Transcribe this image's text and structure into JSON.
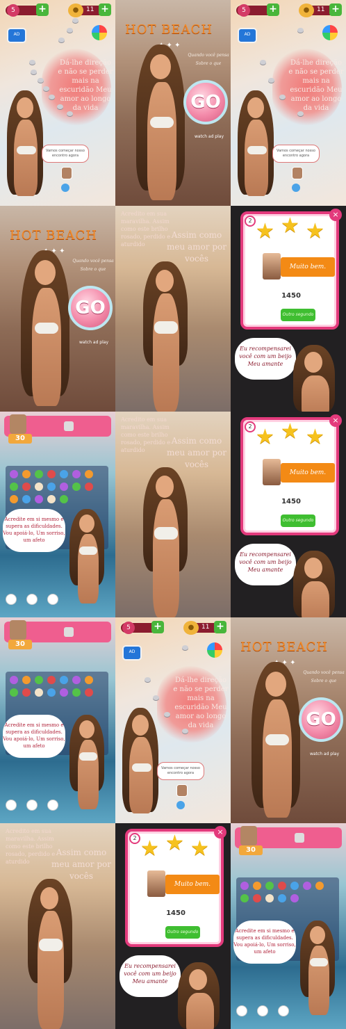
{
  "colors": {
    "accent_pink": "#e33a7c",
    "title_orange": "#f28a2a",
    "ok_green": "#3fbe31",
    "msg_orange": "#f38a15"
  },
  "map": {
    "lives": "5",
    "coins": "11",
    "poem": "Dá-lhe direção e não se perder mais na escuridão Meu amor ao longo da vida",
    "bubble": "Vamos começar nosso encontro agora",
    "tv_label": "AD"
  },
  "intro": {
    "title": "HOT BEACH",
    "subtitle": "Quando você pensa  Sobre o que",
    "go_label": "GO",
    "watch_label": "watch ad play"
  },
  "poem_scene": {
    "top_text": "Acredito em sua maravilha. Assim como este brilho rosado, perdido e aturdido",
    "right_text": "Assim como meu amor por vocês"
  },
  "reward": {
    "level": "2",
    "close": "×",
    "message": "Muito bem.",
    "score": "1450",
    "ok_label": "Outro segundo",
    "cloud_text": "Eu recompensarei você com um beijo Meu amante"
  },
  "game": {
    "moves": "30",
    "bubble_text": "Acredite em si mesmo e supera as dificuldades. Vou apoiá-lo, Um sorriso, um afeto"
  }
}
